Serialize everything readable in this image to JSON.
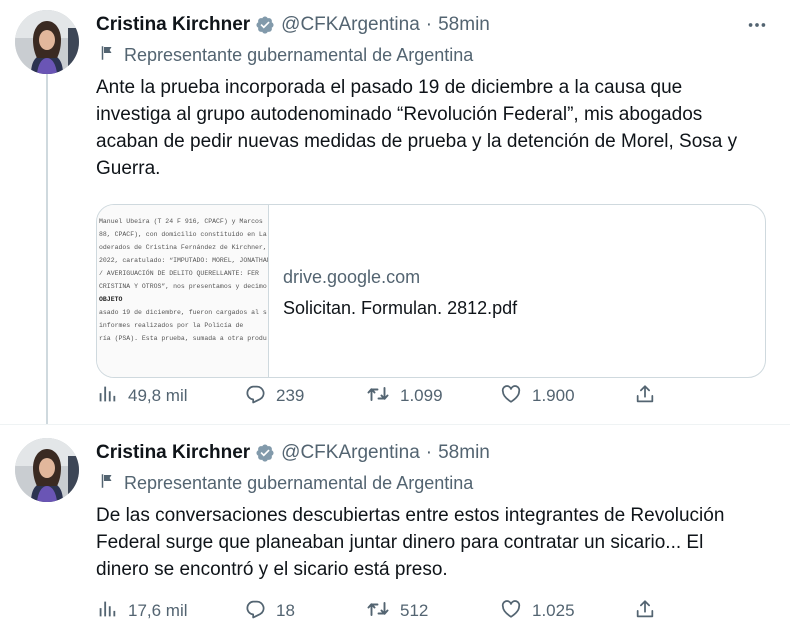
{
  "tweets": [
    {
      "author_name": "Cristina Kirchner",
      "handle": "@CFKArgentina",
      "separator": "·",
      "time": "58min",
      "label": "Representante gubernamental de Argentina",
      "text": "Ante la prueba incorporada el pasado 19 de diciembre a la causa que\ninvestiga al grupo autodenominado “Revolución Federal”, mis abogados\nacaban de pedir nuevas medidas de prueba y la detención de Morel, Sosa y\nGuerra.",
      "card": {
        "domain": "drive.google.com",
        "title": "Solicitan. Formulan. 2812.pdf",
        "thumbnail_lines": [
          "Manuel Ubeira (T 24 F 916, CPACF) y Marcos",
          "88, CPACF), con domicilio constituido en La",
          "oderados de Cristina Fernández de Kirchner,",
          "2022, caratulado: “IMPUTADO: MOREL, JONATHAN",
          "/ AVERIGUACIÓN DE DELITO QUERELLANTE: FER",
          "CRISTINA Y OTROS”, nos presentamos y decimo",
          "OBJETO",
          "asado 19 de diciembre, fueron cargados al s",
          " informes realizados por la Policía de",
          "ría (PSA). Esta prueba, sumada a otra produ"
        ]
      },
      "stats": {
        "views": "49,8 mil",
        "replies": "239",
        "retweets": "1.099",
        "likes": "1.900"
      }
    },
    {
      "author_name": "Cristina Kirchner",
      "handle": "@CFKArgentina",
      "separator": "·",
      "time": "58min",
      "label": "Representante gubernamental de Argentina",
      "text": "De las conversaciones descubiertas entre estos integrantes de Revolución\nFederal surge que planeaban juntar dinero para contratar un sicario... El\ndinero se encontró y el sicario está preso.",
      "stats": {
        "views": "17,6 mil",
        "replies": "18",
        "retweets": "512",
        "likes": "1.025"
      }
    }
  ],
  "colors": {
    "text": "#0f1419",
    "secondary": "#536471",
    "verified": "#829aab",
    "border": "#cfd9de"
  },
  "icons": [
    "verified-badge-icon",
    "more-icon",
    "flag-icon",
    "views-icon",
    "reply-icon",
    "retweet-icon",
    "like-icon",
    "share-icon"
  ]
}
